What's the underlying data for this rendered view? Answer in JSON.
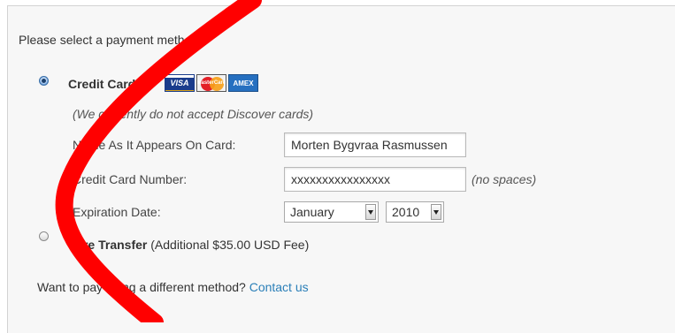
{
  "intro": "Please select a payment method.",
  "credit_card": {
    "label": "Credit Card",
    "cards": [
      "VISA",
      "MasterCard",
      "AMEX"
    ],
    "notice": "(We currently do not accept Discover cards)",
    "name_label": "Name As It Appears On Card:",
    "name_value": "Morten Bygvraa Rasmussen",
    "number_label": "Credit Card Number:",
    "number_value": "xxxxxxxxxxxxxxxx",
    "number_hint": "(no spaces)",
    "expiration_label": "Expiration Date:",
    "month": "January",
    "year": "2010"
  },
  "wire": {
    "label": "Wire Transfer",
    "fee": "(Additional $35.00 USD Fee)"
  },
  "alternate": {
    "text": "Want to pay using a different method?",
    "link": "Contact us"
  },
  "colors": {
    "annotation_stroke": "#ff0000",
    "link": "#2b7fb8"
  }
}
